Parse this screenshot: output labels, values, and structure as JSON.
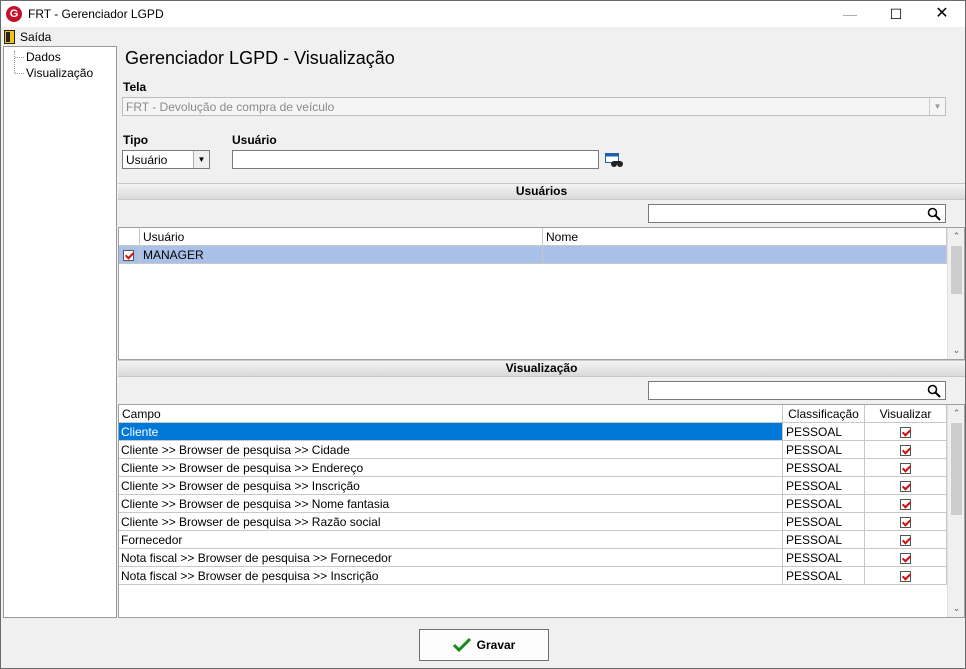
{
  "window": {
    "title": "FRT - Gerenciador LGPD"
  },
  "menu": {
    "exit_label": "Saída"
  },
  "tree": {
    "items": [
      "Dados",
      "Visualização"
    ]
  },
  "page": {
    "title": "Gerenciador LGPD - Visualização"
  },
  "tela": {
    "label": "Tela",
    "value": "FRT - Devolução de compra de veículo"
  },
  "tipo": {
    "label": "Tipo",
    "value": "Usuário"
  },
  "usuario": {
    "label": "Usuário",
    "value": ""
  },
  "usuarios_section": {
    "title": "Usuários",
    "search_value": "",
    "columns": [
      "Usuário",
      "Nome"
    ],
    "rows": [
      {
        "checked": true,
        "usuario": "MANAGER",
        "nome": ""
      }
    ]
  },
  "visualizacao_section": {
    "title": "Visualização",
    "search_value": "",
    "columns": [
      "Campo",
      "Classificação",
      "Visualizar"
    ],
    "rows": [
      {
        "campo": "Cliente",
        "classificacao": "PESSOAL",
        "visualizar": true
      },
      {
        "campo": "Cliente >> Browser de pesquisa >> Cidade",
        "classificacao": "PESSOAL",
        "visualizar": true
      },
      {
        "campo": "Cliente >> Browser de pesquisa >> Endereço",
        "classificacao": "PESSOAL",
        "visualizar": true
      },
      {
        "campo": "Cliente >> Browser de pesquisa >> Inscrição",
        "classificacao": "PESSOAL",
        "visualizar": true
      },
      {
        "campo": "Cliente >> Browser de pesquisa >> Nome fantasia",
        "classificacao": "PESSOAL",
        "visualizar": true
      },
      {
        "campo": "Cliente >> Browser de pesquisa >> Razão social",
        "classificacao": "PESSOAL",
        "visualizar": true
      },
      {
        "campo": "Fornecedor",
        "classificacao": "PESSOAL",
        "visualizar": true
      },
      {
        "campo": "Nota fiscal >> Browser de pesquisa >> Fornecedor",
        "classificacao": "PESSOAL",
        "visualizar": true
      },
      {
        "campo": "Nota fiscal >> Browser de pesquisa >> Inscrição",
        "classificacao": "PESSOAL",
        "visualizar": true
      }
    ]
  },
  "footer": {
    "save_label": "Gravar"
  },
  "colors": {
    "selected_row": "#0078d7",
    "user_row_highlight": "#a9c1e8",
    "check_red": "#d01010"
  }
}
